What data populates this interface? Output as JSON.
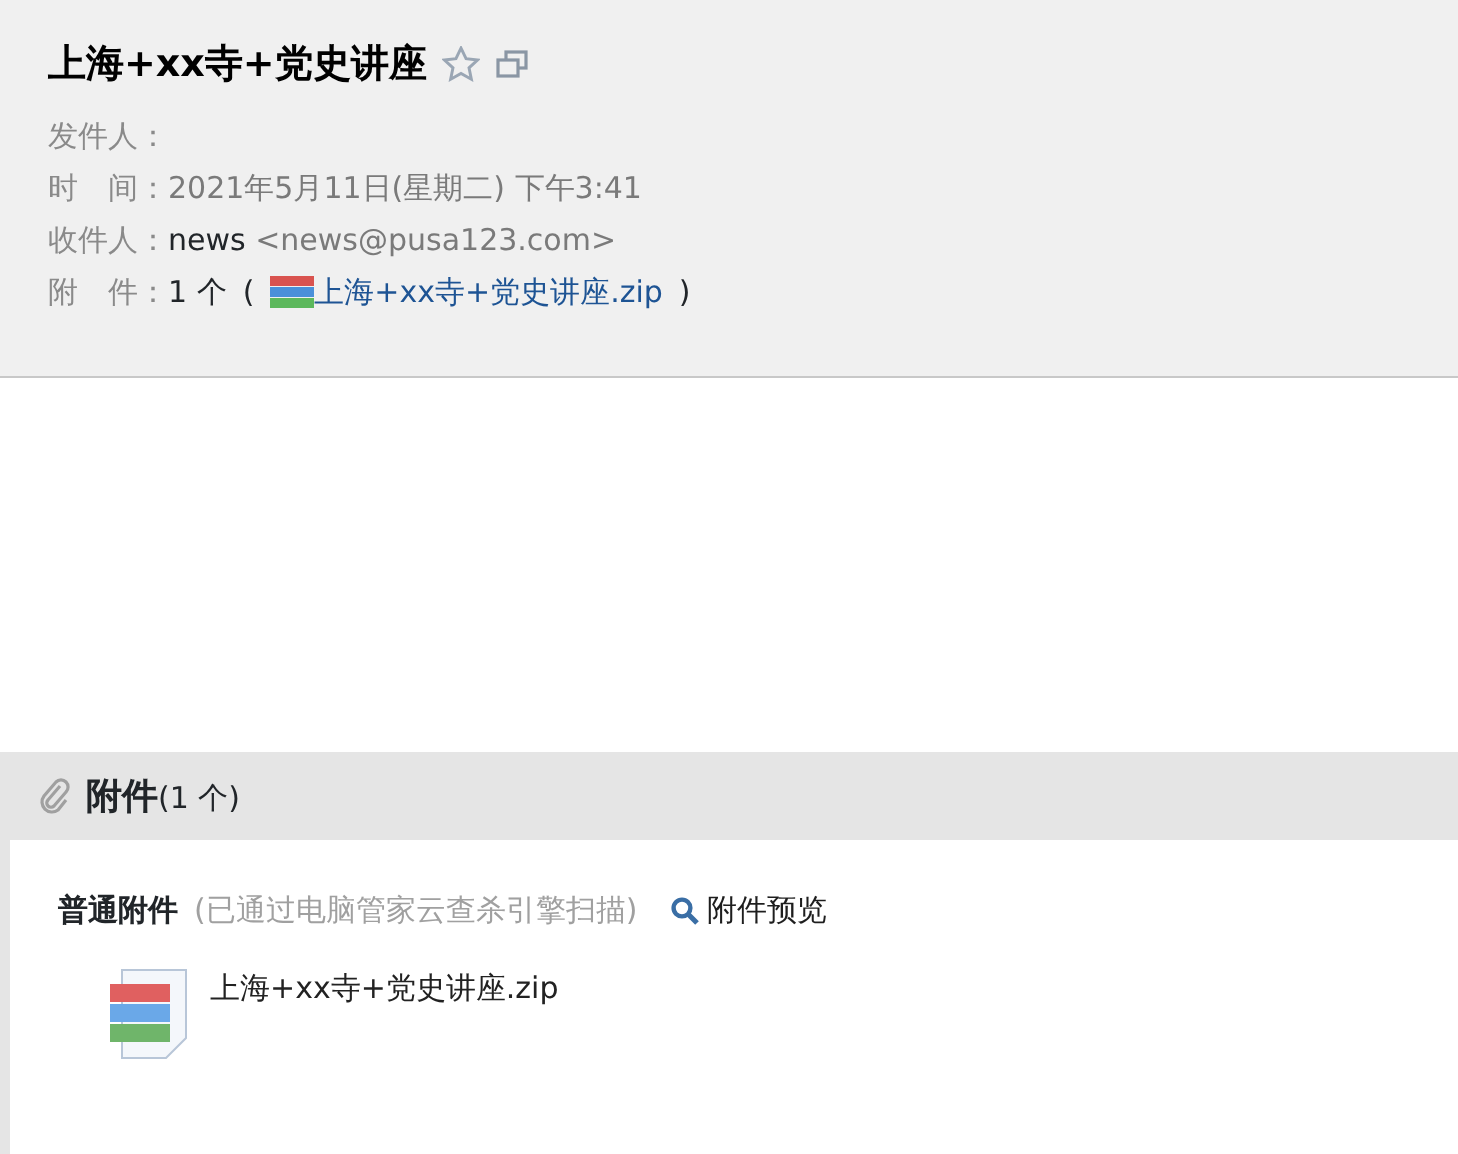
{
  "header": {
    "subject": "上海+xx寺+党史讲座",
    "starred": false,
    "sender_label": "发件人：",
    "time_label": "时　间：",
    "time": "2021年5月11日(星期二) 下午3:41",
    "to_label": "收件人：",
    "to_name": "news",
    "to_address": "<news@pusa123.com>",
    "attach_label": "附　件：",
    "attach_count": "1 个",
    "attach_open": "(",
    "attach_file": "上海+xx寺+党史讲座.zip",
    "attach_close": ")"
  },
  "attachments": {
    "title": "附件",
    "count": "(1 个)",
    "group": "普通附件",
    "note": "(已通过电脑管家云查杀引擎扫描)",
    "preview": "附件预览",
    "files": [
      {
        "name": "上海+xx寺+党史讲座.zip"
      }
    ]
  }
}
